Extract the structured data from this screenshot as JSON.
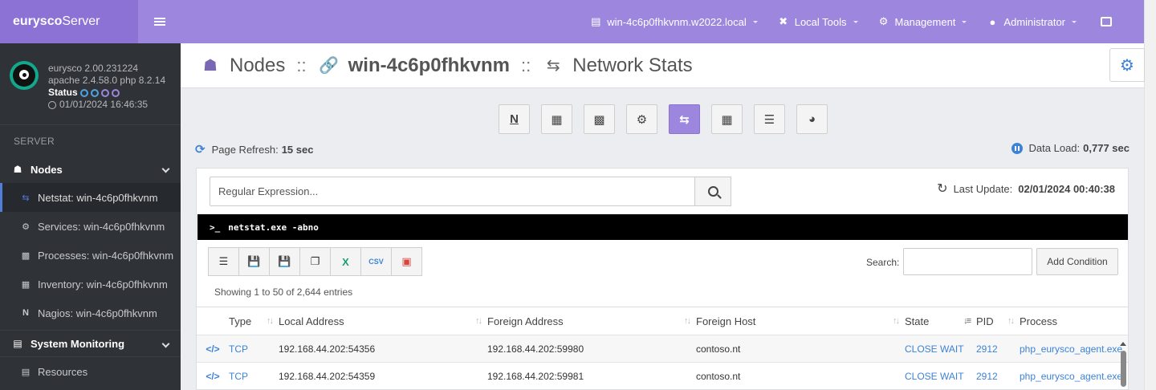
{
  "brand": {
    "name_bold": "eurysco",
    "name_light": "Server"
  },
  "user_panel": {
    "version": "eurysco 2.00.231224",
    "stack": "apache 2.4.58.0  php 8.2.14",
    "status_label": "Status",
    "datetime": "01/01/2024 16:46:35"
  },
  "sidebar": {
    "section": "SERVER",
    "nodes_label": "Nodes",
    "items": [
      {
        "label": "Netstat: win-4c6p0fhkvnm",
        "icon": "exchange-icon"
      },
      {
        "label": "Services: win-4c6p0fhkvnm",
        "icon": "gear-icon"
      },
      {
        "label": "Processes: win-4c6p0fhkvnm",
        "icon": "bar-chart-icon"
      },
      {
        "label": "Inventory: win-4c6p0fhkvnm",
        "icon": "qrcode-icon"
      },
      {
        "label": "Nagios: win-4c6p0fhkvnm",
        "icon": "nagios-icon"
      }
    ],
    "system_monitoring_label": "System Monitoring",
    "resources_label": "Resources"
  },
  "topbar": {
    "server": "win-4c6p0fhkvnm.w2022.local",
    "local_tools": "Local Tools",
    "management": "Management",
    "admin": "Administrator"
  },
  "header": {
    "nodes": "Nodes",
    "sep": "::",
    "host": "win-4c6p0fhkvnm",
    "page": "Network Stats"
  },
  "toolbar": {
    "page_refresh_label": "Page Refresh:",
    "page_refresh_value": "15 sec",
    "data_load_label": "Data Load:",
    "data_load_value": "0,777 sec"
  },
  "panel": {
    "regex_placeholder": "Regular Expression...",
    "last_update_label": "Last Update:",
    "last_update_value": "02/01/2024 00:40:38",
    "command": "netstat.exe -abno",
    "search_label": "Search:",
    "add_condition": "Add Condition",
    "showing": "Showing 1 to 50 of 2,644 entries"
  },
  "table": {
    "headers": [
      "Type",
      "Local Address",
      "Foreign Address",
      "Foreign Host",
      "State",
      "PID",
      "Process"
    ],
    "rows": [
      [
        "TCP",
        "192.168.44.202:54356",
        "192.168.44.202:59980",
        "contoso.nt",
        "CLOSE WAIT",
        "2912",
        "php_eurysco_agent.exe"
      ],
      [
        "TCP",
        "192.168.44.202:54359",
        "192.168.44.202:59981",
        "contoso.nt",
        "CLOSE WAIT",
        "2912",
        "php_eurysco_agent.exe"
      ]
    ]
  },
  "colors": {
    "accent": "#9d86de",
    "link": "#3c83d6",
    "sidebar": "#2f3237"
  }
}
